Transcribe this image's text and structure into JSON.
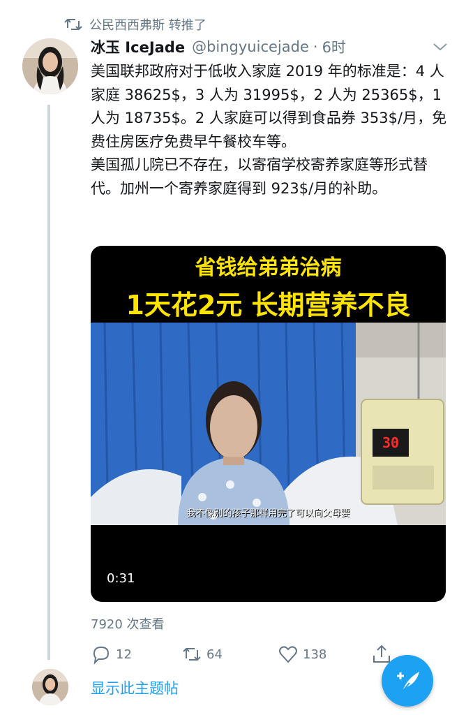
{
  "retweet": {
    "label": "公民西西弗斯 转推了"
  },
  "tweet": {
    "display_name": "冰玉 IceJade",
    "handle": "@bingyuicejade",
    "separator": "·",
    "time": "6时",
    "paragraphs": [
      "美国联邦政府对于低收入家庭 2019 年的标准是：4 人家庭 38625$，3 人为 31995$，2 人为 25365$，1 人为 18735$。2 人家庭可以得到食品券 353$/月，免费住房医疗免费早午餐校车等。",
      "美国孤儿院已不存在，以寄宿学校寄养家庭等形式替代。加州一个寄养家庭得到 923$/月的补助。"
    ],
    "media": {
      "caption_line1": "省钱给弟弟治病",
      "caption_line2": "1天花2元 长期营养不良",
      "subtitle": "我不像别的孩子那样用完了可以向父母要",
      "duration": "0:31",
      "pump_display": "30"
    },
    "views": "7920 次查看",
    "actions": {
      "reply_count": "12",
      "retweet_count": "64",
      "like_count": "138"
    },
    "show_thread": "显示此主题帖"
  },
  "colors": {
    "accent": "#1da1f2",
    "secondary_text": "#657786",
    "primary_text": "#14171a",
    "thread_line": "#ccd6dd"
  },
  "icons": {
    "retweet": "retweet-icon",
    "chevron": "chevron-down-icon",
    "reply": "reply-icon",
    "like": "heart-icon",
    "share": "share-icon",
    "compose": "compose-icon"
  }
}
